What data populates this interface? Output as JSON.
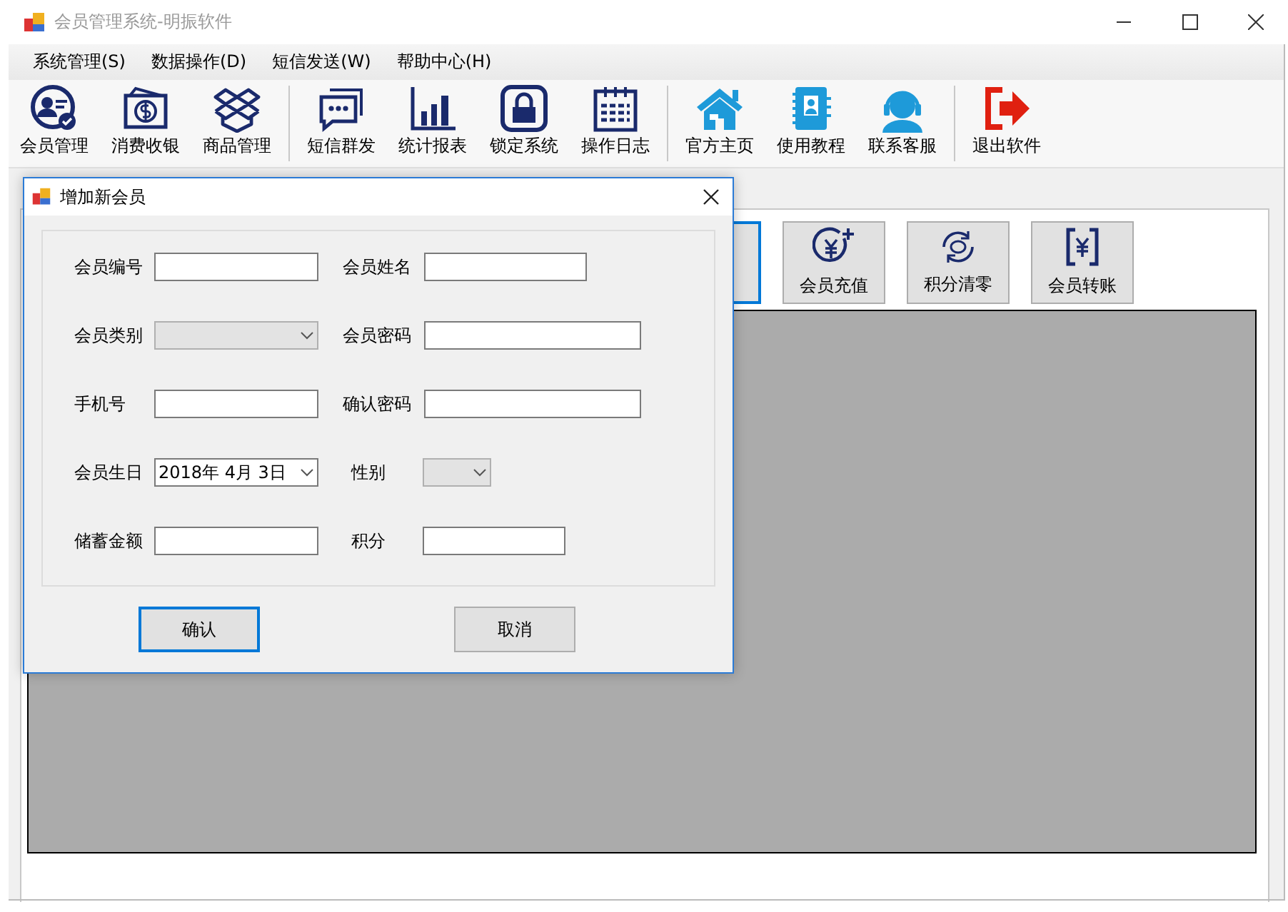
{
  "window": {
    "title": "会员管理系统-明振软件"
  },
  "menus": [
    {
      "label": "系统管理(S)"
    },
    {
      "label": "数据操作(D)"
    },
    {
      "label": "短信发送(W)"
    },
    {
      "label": "帮助中心(H)"
    }
  ],
  "toolbar": [
    [
      {
        "label": "会员管理",
        "kind": "member"
      },
      {
        "label": "消费收银",
        "kind": "cash"
      },
      {
        "label": "商品管理",
        "kind": "box"
      }
    ],
    [
      {
        "label": "短信群发",
        "kind": "chat"
      },
      {
        "label": "统计报表",
        "kind": "chart"
      },
      {
        "label": "锁定系统",
        "kind": "lock"
      },
      {
        "label": "操作日志",
        "kind": "calendar"
      }
    ],
    [
      {
        "label": "官方主页",
        "kind": "home"
      },
      {
        "label": "使用教程",
        "kind": "book"
      },
      {
        "label": "联系客服",
        "kind": "support"
      }
    ],
    [
      {
        "label": "退出软件",
        "kind": "exit"
      }
    ]
  ],
  "modules": [
    {
      "kind": "none",
      "focused": true
    },
    {
      "label": "会员充值",
      "kind": "recharge",
      "focused": false
    },
    {
      "label": "积分清零",
      "kind": "reset",
      "focused": false
    },
    {
      "label": "会员转账",
      "kind": "transfer",
      "focused": false
    }
  ],
  "dialog": {
    "title": "增加新会员",
    "fields": [
      {
        "label": "会员编号",
        "kind": "text",
        "disabled": false
      },
      {
        "label": "会员姓名",
        "kind": "text",
        "disabled": false
      },
      {
        "label": "会员类别",
        "kind": "combo",
        "disabled": true
      },
      {
        "label": "会员密码",
        "kind": "text",
        "disabled": false
      },
      {
        "label": "手机号",
        "kind": "text",
        "disabled": false
      },
      {
        "label": "确认密码",
        "kind": "text",
        "disabled": false
      },
      {
        "label": "会员生日",
        "kind": "date",
        "value": "2018年 4月 3日",
        "disabled": false
      },
      {
        "label": "性别",
        "kind": "combo",
        "disabled": true
      },
      {
        "label": "储蓄金额",
        "kind": "text",
        "disabled": false
      },
      {
        "label": "积分",
        "kind": "text",
        "disabled": false
      }
    ],
    "buttons": [
      {
        "label": "确认",
        "focused": true
      },
      {
        "label": "取消",
        "focused": false
      }
    ]
  }
}
